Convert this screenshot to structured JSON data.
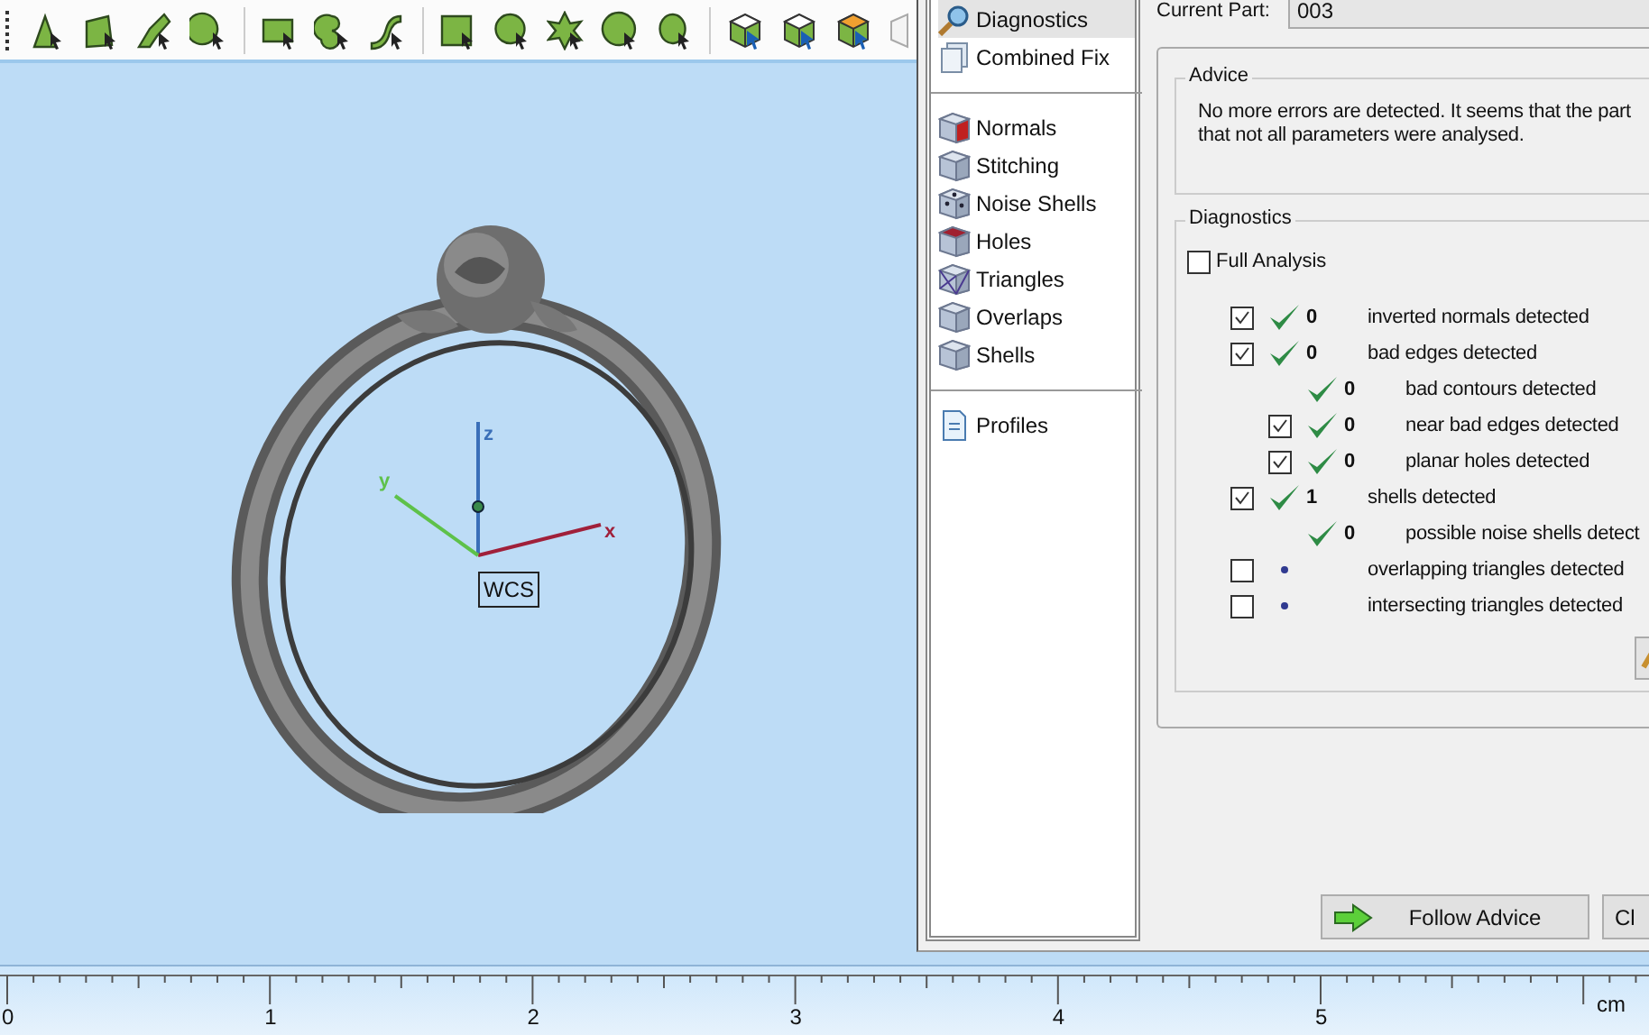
{
  "viewport": {
    "axes": {
      "z": "z",
      "y": "y",
      "x": "x"
    },
    "wcs_label": "WCS"
  },
  "sidebar": {
    "sections": [
      {
        "items": [
          {
            "label": "Diagnostics",
            "selected": true
          },
          {
            "label": "Combined Fix",
            "selected": false
          }
        ]
      },
      {
        "items": [
          {
            "label": "Normals",
            "selected": false
          },
          {
            "label": "Stitching",
            "selected": false
          },
          {
            "label": "Noise Shells",
            "selected": false
          },
          {
            "label": "Holes",
            "selected": false
          },
          {
            "label": "Triangles",
            "selected": false
          },
          {
            "label": "Overlaps",
            "selected": false
          },
          {
            "label": "Shells",
            "selected": false
          }
        ]
      },
      {
        "items": [
          {
            "label": "Profiles",
            "selected": false
          }
        ]
      }
    ]
  },
  "current_part": {
    "label": "Current Part:",
    "value": "003"
  },
  "advice": {
    "title": "Advice",
    "lines": [
      "No more errors are detected. It seems that the part",
      "that not all parameters were analysed."
    ]
  },
  "diagnostics": {
    "title": "Diagnostics",
    "full_analysis": {
      "label": "Full Analysis",
      "checked": false
    },
    "rows": [
      {
        "checked": true,
        "kind": "ok",
        "count": "0",
        "label": "inverted normals detected"
      },
      {
        "checked": true,
        "kind": "ok",
        "count": "0",
        "label": "bad edges detected",
        "children": [
          {
            "kind": "ok",
            "count": "0",
            "label": "bad contours detected"
          },
          {
            "checked": true,
            "kind": "ok",
            "count": "0",
            "label": "near bad edges detected"
          },
          {
            "checked": true,
            "kind": "ok",
            "count": "0",
            "label": "planar holes detected"
          }
        ]
      },
      {
        "checked": true,
        "kind": "ok",
        "count": "1",
        "label": "shells detected",
        "children": [
          {
            "kind": "ok",
            "count": "0",
            "label": "possible noise shells detect"
          }
        ]
      },
      {
        "checked": false,
        "kind": "pending",
        "label": "overlapping triangles detected"
      },
      {
        "checked": false,
        "kind": "pending",
        "label": "intersecting triangles detected"
      }
    ]
  },
  "buttons": [
    {
      "label": "Follow Advice",
      "kind": "arrow"
    },
    {
      "label": "Cl",
      "kind": "plain"
    }
  ],
  "ruler": {
    "labels": [
      "0",
      "1",
      "2",
      "3",
      "4",
      "5"
    ],
    "unit": "cm"
  }
}
